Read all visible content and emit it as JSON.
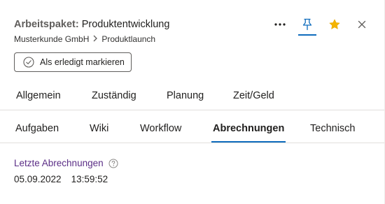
{
  "header": {
    "title_prefix": "Arbeitspaket:",
    "title_name": "Produktentwicklung",
    "breadcrumb": [
      "Musterkunde GmbH",
      "Produktlaunch"
    ],
    "actions": [
      {
        "icon": "more-icon",
        "active": false
      },
      {
        "icon": "pin-icon",
        "active": true
      },
      {
        "icon": "star-icon",
        "active": true
      },
      {
        "icon": "close-icon",
        "active": false
      }
    ]
  },
  "mark_done_button": {
    "label": "Als erledigt markieren",
    "icon": "check-circle-icon"
  },
  "tabs_row1": [
    "Allgemein",
    "Zuständig",
    "Planung",
    "Zeit/Geld"
  ],
  "tabs_row2": [
    "Aufgaben",
    "Wiki",
    "Workflow",
    "Abrechnungen",
    "Technisch"
  ],
  "active_tab": "Abrechnungen",
  "section": {
    "title": "Letzte Abrechnungen",
    "help_icon": "help-circle-icon",
    "date": "05.09.2022",
    "time": "13:59:52"
  },
  "colors": {
    "accent": "#0f6cbd",
    "star": "#f4b400",
    "section_title": "#5b2e86"
  }
}
